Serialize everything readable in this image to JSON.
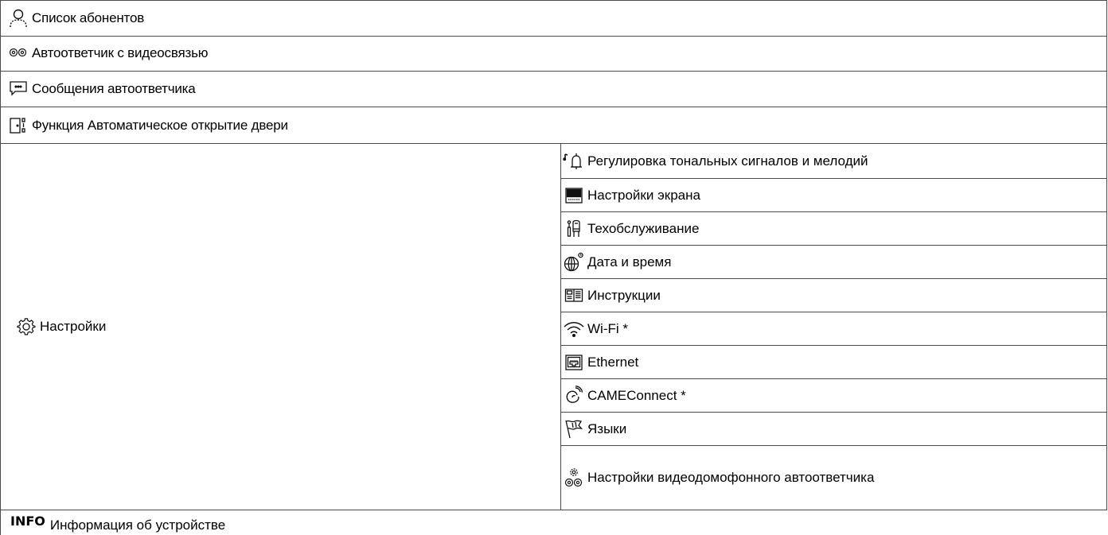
{
  "menu": {
    "subscribers": {
      "label": "Список абонентов",
      "icon": "user-icon"
    },
    "video_answering_machine": {
      "label": "Автоответчик с видеосвязью",
      "icon": "voicemail-icon"
    },
    "answering_machine_messages": {
      "label": "Сообщения автоответчика",
      "icon": "message-bubble-icon"
    },
    "auto_door_open": {
      "label": "Функция Автоматическое открытие двери",
      "icon": "door-icon"
    },
    "settings": {
      "label": "Настройки",
      "icon": "gear-icon",
      "items": [
        {
          "label": "Регулировка тональных сигналов и мелодий",
          "icon": "bell-music-icon"
        },
        {
          "label": "Настройки экрана",
          "icon": "monitor-icon"
        },
        {
          "label": "Техобслуживание",
          "icon": "tools-icon"
        },
        {
          "label": "Дата и время",
          "icon": "globe-clock-icon"
        },
        {
          "label": "Инструкции",
          "icon": "book-icon"
        },
        {
          "label": "Wi-Fi *",
          "icon": "wifi-icon"
        },
        {
          "label": "Ethernet",
          "icon": "ethernet-icon"
        },
        {
          "label": "CAMEConnect *",
          "icon": "cameconnect-icon"
        },
        {
          "label": "Языки",
          "icon": "flag-icon"
        },
        {
          "label": "Настройки видеодомофонного автоответчика",
          "icon": "voicemail-settings-icon"
        }
      ]
    },
    "device_info": {
      "tag": "INFO",
      "label": "Информация об устройстве"
    }
  }
}
